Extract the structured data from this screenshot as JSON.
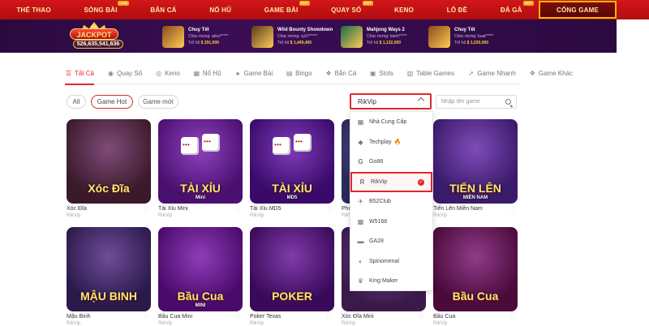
{
  "nav": {
    "items": [
      {
        "label": "THỂ THAO",
        "badge": ""
      },
      {
        "label": "SÒNG BÀI",
        "badge": "LIVE"
      },
      {
        "label": "BẮN CÁ",
        "badge": ""
      },
      {
        "label": "NỔ HŨ",
        "badge": ""
      },
      {
        "label": "GAME BÀI",
        "badge": "HOT"
      },
      {
        "label": "QUAY SỐ",
        "badge": "HOT"
      },
      {
        "label": "KENO",
        "badge": ""
      },
      {
        "label": "LÔ ĐỀ",
        "badge": ""
      },
      {
        "label": "ĐÁ GÀ",
        "badge": "HOT"
      }
    ],
    "portal_label": "CỔNG GAME",
    "colors": {
      "bar": "#c8111a",
      "text": "#ffe9a0",
      "highlight_border": "#f5b400"
    }
  },
  "jackpot": {
    "title": "JACKPOT",
    "amount": "526,635,541,636",
    "winners": [
      {
        "game": "Chuy Tết",
        "msg": "Chúc mừng: abcs*****",
        "prize_label": "Trổ hũ",
        "prize": "$ 291,000",
        "thumb": "#8a4a1a"
      },
      {
        "game": "Wild Bounty Showdown",
        "msg": "Chúc mừng: vy97*****",
        "prize_label": "Trổ hũ",
        "prize": "$ 1,449,400",
        "thumb": "#5a3a1a"
      },
      {
        "game": "Mahjong Ways 2",
        "msg": "Chúc mừng: lamh*****",
        "prize_label": "Trổ hũ",
        "prize": "$ 1,132,000",
        "thumb": "#1a6a4a"
      },
      {
        "game": "Chuy Tết",
        "msg": "Chúc mừng: buat*****",
        "prize_label": "Trổ hũ",
        "prize": "$ 1,020,000",
        "thumb": "#8a4a1a"
      }
    ]
  },
  "tabs": [
    {
      "label": "Tất Cả",
      "icon": "list-icon",
      "glyph": "☰",
      "active": true
    },
    {
      "label": "Quay Số",
      "icon": "lottery-icon",
      "glyph": "◉",
      "active": false
    },
    {
      "label": "Keno",
      "icon": "keno-icon",
      "glyph": "◎",
      "active": false
    },
    {
      "label": "Nổ Hũ",
      "icon": "slot-icon",
      "glyph": "▦",
      "active": false
    },
    {
      "label": "Game Bài",
      "icon": "cards-icon",
      "glyph": "♠",
      "active": false
    },
    {
      "label": "Bingo",
      "icon": "bingo-icon",
      "glyph": "▤",
      "active": false
    },
    {
      "label": "Bắn Cá",
      "icon": "fish-icon",
      "glyph": "❖",
      "active": false
    },
    {
      "label": "Slots",
      "icon": "slots-icon",
      "glyph": "▣",
      "active": false
    },
    {
      "label": "Table Games",
      "icon": "table-icon",
      "glyph": "▥",
      "active": false
    },
    {
      "label": "Game Nhanh",
      "icon": "rocket-icon",
      "glyph": "➚",
      "active": false
    },
    {
      "label": "Game Khác",
      "icon": "gamepad-icon",
      "glyph": "✥",
      "active": false
    }
  ],
  "filters": [
    {
      "label": "All",
      "active": false
    },
    {
      "label": "Game Hot",
      "active": true
    },
    {
      "label": "Game mới",
      "active": false
    }
  ],
  "provider_select": {
    "value": "RikVip"
  },
  "search": {
    "placeholder": "Nhập tên game"
  },
  "dropdown": [
    {
      "label": "Nhà Cung Cấp",
      "icon": "grid-icon",
      "glyph": "▦",
      "selected": false,
      "hot": false
    },
    {
      "label": "Techplay",
      "icon": "techplay-icon",
      "glyph": "◆",
      "selected": false,
      "hot": true
    },
    {
      "label": "Go88",
      "icon": "go88-icon",
      "glyph": "G",
      "selected": false,
      "hot": false
    },
    {
      "label": "RikVip",
      "icon": "rikvip-icon",
      "glyph": "R",
      "selected": true,
      "hot": false
    },
    {
      "label": "B52Club",
      "icon": "b52-icon",
      "glyph": "✈",
      "selected": false,
      "hot": false
    },
    {
      "label": "W5168",
      "icon": "w5168-icon",
      "glyph": "▩",
      "selected": false,
      "hot": false
    },
    {
      "label": "GA28",
      "icon": "ga28-icon",
      "glyph": "▬",
      "selected": false,
      "hot": false
    },
    {
      "label": "Spinomenal",
      "icon": "spinomenal-icon",
      "glyph": "◐",
      "selected": false,
      "hot": false
    },
    {
      "label": "King Maker",
      "icon": "kingmaker-icon",
      "glyph": "♛",
      "selected": false,
      "hot": false
    }
  ],
  "games": [
    {
      "name": "Xóc Đĩa",
      "provider": "RikVip",
      "art": "Xóc Đĩa",
      "sub": "",
      "bg": "#3a1a2a"
    },
    {
      "name": "Tài Xỉu Mini",
      "provider": "RikVip",
      "art": "TÀI XỈU",
      "sub": "Mini",
      "bg": "#4a1070"
    },
    {
      "name": "Tài Xỉu MD5",
      "provider": "RikVip",
      "art": "TÀI XỈU",
      "sub": "MD5",
      "bg": "#3a0a6a"
    },
    {
      "name": "Phỏm",
      "provider": "RikVip",
      "art": "",
      "sub": "",
      "bg": "#2a2a5a"
    },
    {
      "name": "Tiến Lên Miền Nam",
      "provider": "RikVip",
      "art": "TIẾN LÊN",
      "sub": "MIỀN NAM",
      "bg": "#3a1a6a"
    },
    {
      "name": "Mậu Binh",
      "provider": "RikVip",
      "art": "MẬU BINH",
      "sub": "",
      "bg": "#2a1a4a"
    },
    {
      "name": "Bầu Cua Mini",
      "provider": "RikVip",
      "art": "Bầu Cua",
      "sub": "MINI",
      "bg": "#4a0a6a"
    },
    {
      "name": "Poker Texas",
      "provider": "RikVip",
      "art": "POKER",
      "sub": "",
      "bg": "#3a0a5a"
    },
    {
      "name": "Xóc Đĩa Mini",
      "provider": "RikVip",
      "art": "",
      "sub": "",
      "bg": "#3a1a4a"
    },
    {
      "name": "Bầu Cua",
      "provider": "RikVip",
      "art": "Bầu Cua",
      "sub": "",
      "bg": "#4a0a3a"
    }
  ],
  "colors": {
    "accent": "#e0282e",
    "jackpot_bg": "#2f0b46"
  }
}
